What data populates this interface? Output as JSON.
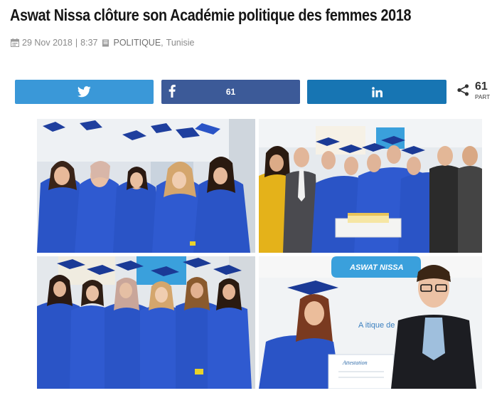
{
  "article": {
    "title": "Aswat Nissa clôture son Académie politique des femmes 2018",
    "date": "29 Nov 2018",
    "separator": "|",
    "time": "8:37",
    "category": "POLITIQUE",
    "comma": ",",
    "tag": "Tunisie"
  },
  "share": {
    "facebook_count": "61",
    "total_count": "61",
    "total_label": "PART"
  },
  "photos": {
    "attestation_text": "Attestation",
    "banner_text": "ASWAT NISSA",
    "banner_subtext": "A    itique de",
    "colors": {
      "gown": "#2a54c6",
      "gown_dark": "#1b3a96",
      "banner": "#3aa0dc",
      "wall": "#e9edf0"
    }
  },
  "colors": {
    "twitter": "#3a98d8",
    "facebook": "#3c5a98",
    "linkedin": "#1775b3",
    "meta_text": "#8b8b8b",
    "title_text": "#161616"
  }
}
